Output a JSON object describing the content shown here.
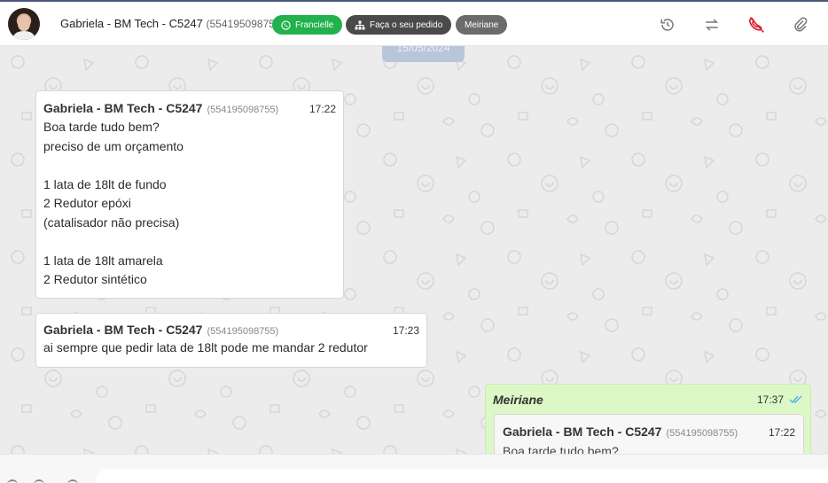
{
  "header": {
    "contact_name": "Gabriela - BM Tech - C5247",
    "contact_phone": "(554195098755)",
    "tags": [
      {
        "label": "Francielle",
        "icon": "whatsapp-icon",
        "color": "#22b14c"
      },
      {
        "label": "Faça o seu pedido",
        "icon": "org-chart-icon",
        "color": "#4a4a4a"
      },
      {
        "label": "Meiriane",
        "color": "#6b6b6b"
      }
    ],
    "actions": [
      {
        "name": "history-icon"
      },
      {
        "name": "transfer-icon"
      },
      {
        "name": "end-call-icon",
        "color": "#d9263a"
      },
      {
        "name": "attach-icon"
      }
    ]
  },
  "chat": {
    "date_label": "15/05/2024",
    "messages": [
      {
        "sender": "Gabriela - BM Tech - C5247",
        "phone": "(554195098755)",
        "time": "17:22",
        "lines": [
          "Boa tarde tudo bem?",
          "preciso de um orçamento",
          "",
          "1 lata de 18lt de fundo",
          "2 Redutor epóxi",
          "(catalisador não precisa)",
          "",
          "1 lata de 18lt amarela",
          "2 Redutor sintético"
        ]
      },
      {
        "sender": "Gabriela - BM Tech - C5247",
        "phone": "(554195098755)",
        "time": "17:23",
        "lines": [
          "ai sempre que pedir lata de 18lt pode me mandar 2 redutor"
        ]
      }
    ],
    "outgoing": {
      "author": "Meiriane",
      "time": "17:37",
      "status": "read",
      "tick_color": "#4fb6ec",
      "quote": {
        "sender": "Gabriela - BM Tech - C5247",
        "phone": "(554195098755)",
        "time": "17:22",
        "first_line": "Boa tarde tudo bem?"
      }
    }
  },
  "colors": {
    "outgoing_bubble": "#dcf8c6",
    "chat_background": "#ececec",
    "accent_green": "#22b14c"
  }
}
